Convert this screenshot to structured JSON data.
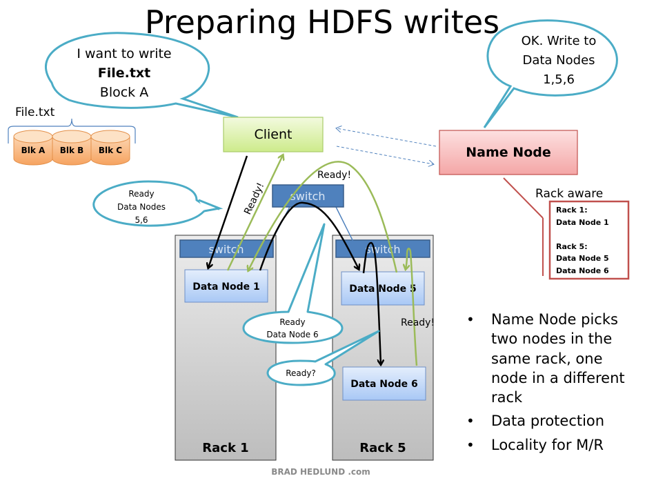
{
  "title": "Preparing HDFS writes",
  "client_bubble": {
    "line1": "I want to write",
    "line2": "File.txt",
    "line3": "Block A"
  },
  "namenode_bubble": {
    "line1": "OK. Write to",
    "line2": "Data Nodes",
    "line3": "1,5,6"
  },
  "file": {
    "label": "File.txt",
    "blocks": [
      "Blk A",
      "Blk B",
      "Blk C"
    ]
  },
  "client": {
    "label": "Client"
  },
  "name_node": {
    "label": "Name Node"
  },
  "rack_aware": {
    "heading": "Rack aware",
    "lines": [
      "Rack 1:",
      "Data Node 1",
      "",
      "Rack 5:",
      "Data Node 5",
      "Data Node 6"
    ]
  },
  "core_switch": {
    "label": "switch"
  },
  "racks": [
    {
      "label": "Rack 1",
      "switch": "switch",
      "nodes": [
        "Data Node 1"
      ]
    },
    {
      "label": "Rack 5",
      "switch": "switch",
      "nodes": [
        "Data Node 5",
        "Data Node 6"
      ]
    }
  ],
  "ready_bubble_dn56": {
    "line1": "Ready",
    "line2": "Data Nodes",
    "line3": "5,6"
  },
  "ready_bubble_dn6": {
    "line1": "Ready",
    "line2": "Data Node  6"
  },
  "ready_question_bubble": {
    "text": "Ready?"
  },
  "ready_labels": {
    "client_link": "Ready!",
    "top_arc": "Ready!",
    "rack5": "Ready!"
  },
  "bullets": [
    {
      "lines": [
        "Name Node picks",
        "two nodes in the",
        "same rack, one",
        "node in a different",
        "rack"
      ]
    },
    {
      "lines": [
        "Data protection"
      ]
    },
    {
      "lines": [
        "Locality for M/R"
      ]
    }
  ],
  "footer": "BRAD HEDLUND .com",
  "colors": {
    "bubble_stroke": "#4bacc6",
    "green_arrow": "#9bbb59",
    "switch_fill": "#4f81bd",
    "rack_aware_border": "#c0504d"
  }
}
